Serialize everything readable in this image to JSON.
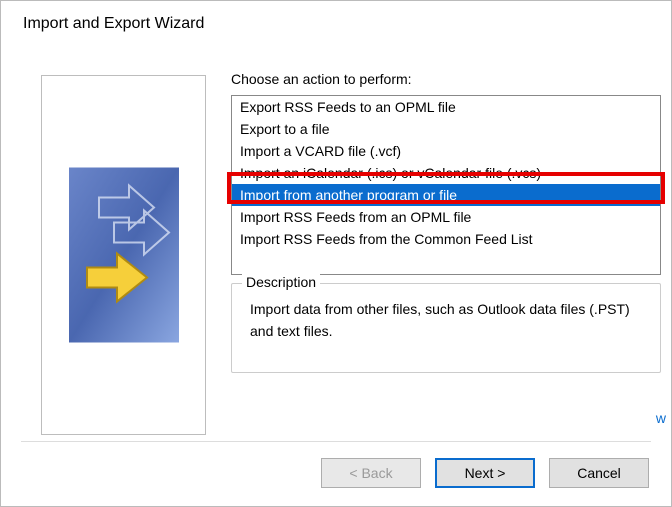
{
  "window": {
    "title": "Import and Export Wizard"
  },
  "action": {
    "label": "Choose an action to perform:",
    "items": [
      "Export RSS Feeds to an OPML file",
      "Export to a file",
      "Import a VCARD file (.vcf)",
      "Import an iCalendar (.ics) or vCalendar file (.vcs)",
      "Import from another program or file",
      "Import RSS Feeds from an OPML file",
      "Import RSS Feeds from the Common Feed List"
    ],
    "selected_index": 4
  },
  "description": {
    "legend": "Description",
    "text": "Import data from other files, such as Outlook data files (.PST) and text files."
  },
  "buttons": {
    "back": "< Back",
    "next": "Next >",
    "cancel": "Cancel"
  }
}
